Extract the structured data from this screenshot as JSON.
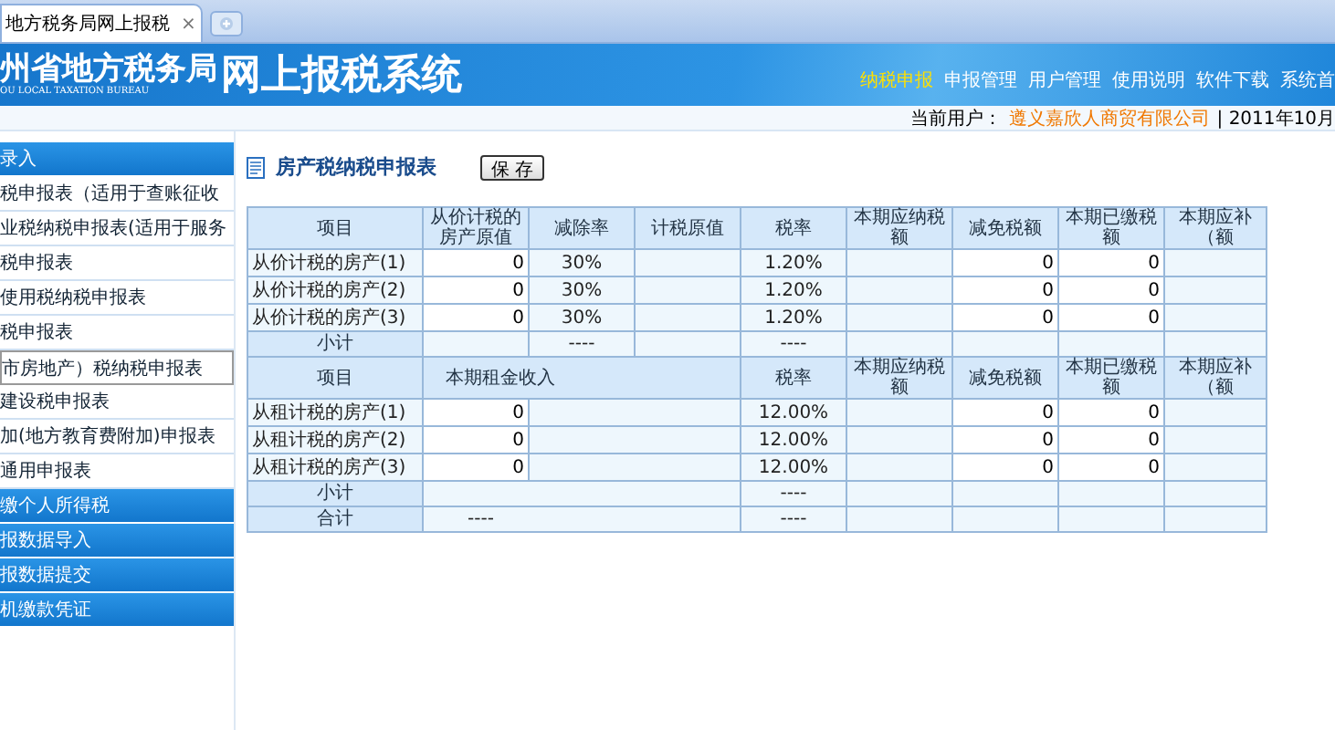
{
  "browser_tab": {
    "title": "地方税务局网上报税",
    "close": "×"
  },
  "header": {
    "org_name": "州省地方税务局",
    "org_name_en": "OU LOCAL TAXATION BUREAU",
    "system_name": "网上报税系统",
    "nav": [
      {
        "label": "纳税申报",
        "selected": true
      },
      {
        "label": "申报管理",
        "selected": false
      },
      {
        "label": "用户管理",
        "selected": false
      },
      {
        "label": "使用说明",
        "selected": false
      },
      {
        "label": "软件下载",
        "selected": false
      },
      {
        "label": "系统首",
        "selected": false
      }
    ]
  },
  "user_bar": {
    "label": "当前用户：",
    "user": "遵义嘉欣人商贸有限公司",
    "date": "| 2011年10月"
  },
  "sidebar": [
    {
      "kind": "group",
      "label": "录入",
      "selected": false
    },
    {
      "kind": "item",
      "label": "税申报表（适用于查账征收",
      "selected": false
    },
    {
      "kind": "item",
      "label": "业税纳税申报表(适用于服务",
      "selected": false
    },
    {
      "kind": "item",
      "label": "税申报表",
      "selected": false
    },
    {
      "kind": "item",
      "label": "使用税纳税申报表",
      "selected": false
    },
    {
      "kind": "item",
      "label": "税申报表",
      "selected": false
    },
    {
      "kind": "item",
      "label": "市房地产）税纳税申报表",
      "selected": true
    },
    {
      "kind": "item",
      "label": "建设税申报表",
      "selected": false
    },
    {
      "kind": "item",
      "label": "加(地方教育费附加)申报表",
      "selected": false
    },
    {
      "kind": "item",
      "label": "通用申报表",
      "selected": false
    },
    {
      "kind": "group",
      "label": "缴个人所得税",
      "selected": false
    },
    {
      "kind": "group",
      "label": "报数据导入",
      "selected": false
    },
    {
      "kind": "group",
      "label": "报数据提交",
      "selected": false
    },
    {
      "kind": "group",
      "label": "机缴款凭证",
      "selected": false
    }
  ],
  "form": {
    "title": "房产税纳税申报表",
    "save_button": "保 存"
  },
  "table": {
    "rows": [
      {
        "kind": "price_header",
        "item": "项目",
        "original_value": "从价计税的房产原值",
        "deduction_rate": "减除率",
        "taxable_value": "计税原值",
        "tax_rate": "税率",
        "payable": "本期应纳税额",
        "reduction": "减免税额",
        "paid": "本期已缴税额",
        "due": "本期应补（额"
      },
      {
        "kind": "price",
        "item": "从价计税的房产(1)",
        "original_value": "0",
        "deduction_rate": "30%",
        "tax_rate": "1.20%",
        "reduction": "0",
        "paid": "0"
      },
      {
        "kind": "price",
        "item": "从价计税的房产(2)",
        "original_value": "0",
        "deduction_rate": "30%",
        "tax_rate": "1.20%",
        "reduction": "0",
        "paid": "0"
      },
      {
        "kind": "price",
        "item": "从价计税的房产(3)",
        "original_value": "0",
        "deduction_rate": "30%",
        "tax_rate": "1.20%",
        "reduction": "0",
        "paid": "0"
      },
      {
        "kind": "price_subtotal",
        "item": "小计",
        "deduction_rate": "----",
        "tax_rate": "----"
      },
      {
        "kind": "rent_header",
        "item": "项目",
        "rent_income": "本期租金收入",
        "tax_rate": "税率",
        "payable": "本期应纳税额",
        "reduction": "减免税额",
        "paid": "本期已缴税额",
        "due": "本期应补（额"
      },
      {
        "kind": "rent",
        "item": "从租计税的房产(1)",
        "rent_income": "0",
        "tax_rate": "12.00%",
        "reduction": "0",
        "paid": "0"
      },
      {
        "kind": "rent",
        "item": "从租计税的房产(2)",
        "rent_income": "0",
        "tax_rate": "12.00%",
        "reduction": "0",
        "paid": "0"
      },
      {
        "kind": "rent",
        "item": "从租计税的房产(3)",
        "rent_income": "0",
        "tax_rate": "12.00%",
        "reduction": "0",
        "paid": "0"
      },
      {
        "kind": "rent_subtotal",
        "item": "小计",
        "tax_rate": "----"
      },
      {
        "kind": "total",
        "item": "合计",
        "rent_income": "----",
        "tax_rate": "----"
      }
    ]
  }
}
